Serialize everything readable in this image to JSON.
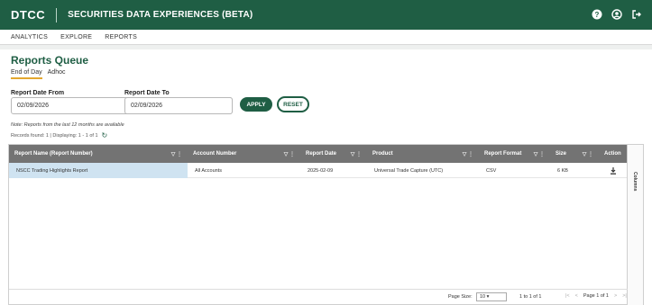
{
  "header": {
    "logo": "DTCC",
    "title": "SECURITIES DATA EXPERIENCES (BETA)"
  },
  "nav": {
    "items": [
      "ANALYTICS",
      "EXPLORE",
      "REPORTS"
    ]
  },
  "page": {
    "title": "Reports Queue",
    "tabs": [
      "End of Day",
      "Adhoc"
    ]
  },
  "filters": {
    "from_label": "Report Date From",
    "from_value": "02/09/2026",
    "to_label": "Report Date To",
    "to_value": "02/09/2026",
    "apply_label": "APPLY",
    "reset_label": "RESET"
  },
  "note": "Note: Reports from the last 12 months are available",
  "records": "Records found: 1 | Displaying: 1 - 1 of 1",
  "table": {
    "columns": [
      "Report Name (Report Number)",
      "Account Number",
      "Report Date",
      "Product",
      "Report Format",
      "Size",
      "Action"
    ],
    "rows": [
      [
        "NSCC Trading Highlights Report",
        "All Accounts",
        "2025-02-09",
        "Universal Trade Capture (UTC)",
        "CSV",
        "6 KB",
        ""
      ]
    ],
    "side_panel": "Columns"
  },
  "pagination": {
    "page_size_label": "Page Size:",
    "page_size_value": "10",
    "range": "1 to 1 of 1",
    "page": "Page 1 of 1"
  }
}
